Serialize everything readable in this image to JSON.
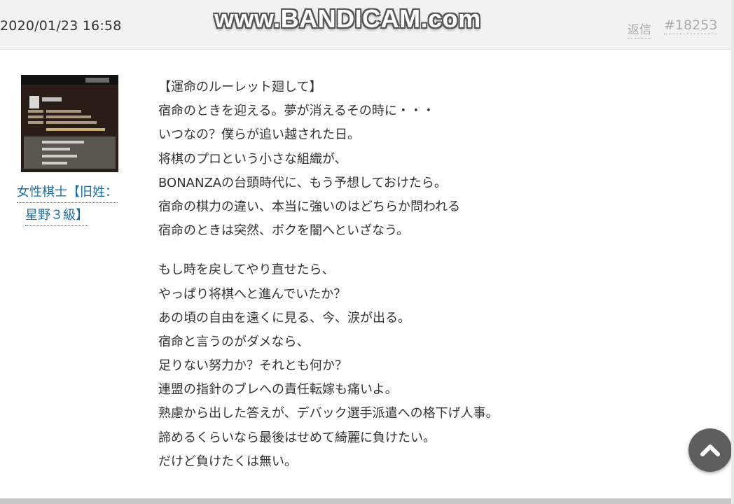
{
  "post": {
    "date": "2020/01/23 16:58",
    "reply_label": "返信",
    "number": "#18253"
  },
  "watermark": "www.BANDICAM.com",
  "user": {
    "name_line1": "女性棋士【旧姓：",
    "name_line2": "星野３級】"
  },
  "body": {
    "stanza1": [
      "【運命のルーレット廻して】",
      "宿命のときを迎える。夢が消えるその時に・・・",
      "いつなの？僕らが追い越された日。",
      "将棋のプロという小さな組織が、",
      "BONANZAの台頭時代に、もう予想しておけたら。",
      "宿命の棋力の違い、本当に強いのはどちらか問われる",
      "宿命のときは突然、ボクを闇へといざなう。"
    ],
    "stanza2": [
      "もし時を戻してやり直せたら、",
      "やっぱり将棋へと進んでいたか？",
      "あの頃の自由を遠くに見る、今、涙が出る。",
      "宿命と言うのがダメなら、",
      "足りない努力か？それとも何か？",
      "連盟の指針のブレへの責任転嫁も痛いよ。",
      "熟慮から出した答えが、デバック選手派遣への格下げ人事。",
      "諦めるくらいなら最後はせめて綺麗に負けたい。",
      "だけど負けたくは無い。"
    ]
  },
  "icons": {
    "scroll_top": "chevron-up-icon",
    "avatar": "avatar-image"
  },
  "colors": {
    "header_bg": "#f2f2f2",
    "link": "#1a6fa8",
    "muted": "#aaaaaa",
    "scroll_button": "#5e5e5e"
  }
}
